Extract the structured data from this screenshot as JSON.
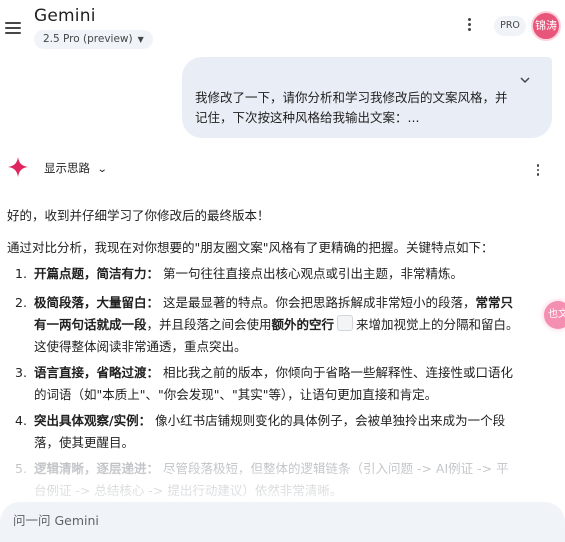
{
  "header": {
    "app_title": "Gemini",
    "model_selector": "2.5 Pro (preview)",
    "pro_badge": "PRO",
    "avatar_text": "锦涛"
  },
  "user_message": {
    "text": "我修改了一下，请你分析和学习我修改后的文案风格，并记住，下次按这种风格给我输出文案：..."
  },
  "response": {
    "show_thinking_label": "显示思路",
    "intro": "好的，收到并仔细学习了你修改后的最终版本！",
    "analysis_lead": "通过对比分析，我现在对你想要的\"朋友圈文案\"风格有了更精确的把握。关键特点如下：",
    "points": [
      {
        "number": "1.",
        "title": "开篇点题，简洁有力：",
        "text": "第一句往往直接点出核心观点或引出主题，非常精炼。"
      },
      {
        "number": "2.",
        "title": "极简段落，大量留白：",
        "text_1": "这是最显著的特点。你会把思路拆解成非常短小的段落，",
        "bold_1": "常常只有一两句话就成一段",
        "text_2": "，并且段落之间会使用",
        "bold_2": "额外的空行",
        "text_3": "来增加视觉上的分隔和留白。这使得整体阅读非常通透，重点突出。"
      },
      {
        "number": "3.",
        "title": "语言直接，省略过渡：",
        "text": "相比我之前的版本，你倾向于省略一些解释性、连接性或口语化的词语（如\"本质上\"、\"你会发现\"、\"其实\"等），让语句更加直接和肯定。"
      },
      {
        "number": "4.",
        "title": "突出具体观察/实例：",
        "text": "像小红书店铺规则变化的具体例子，会被单独拎出来成为一个段落，使其更醒目。"
      },
      {
        "number": "5.",
        "title": "逻辑清晰，逐层递进：",
        "text": "尽管段落极短，但整体的逻辑链条（引入问题 -> AI例证 -> 平台例证 -> 总结核心 -> 提出行动建议）依然非常清晰。"
      }
    ]
  },
  "side_widget": {
    "text": "也文"
  },
  "input": {
    "placeholder": "问一问 Gemini"
  },
  "colors": {
    "user_bubble": "#e9eef6",
    "pill_bg": "#f0f4f9",
    "gemini_star": "#e0245e",
    "avatar": "#e8557a"
  },
  "icons": [
    "menu-icon",
    "chevron-down-icon",
    "more-vert-icon",
    "expand-icon",
    "gemini-sparkle-icon"
  ]
}
